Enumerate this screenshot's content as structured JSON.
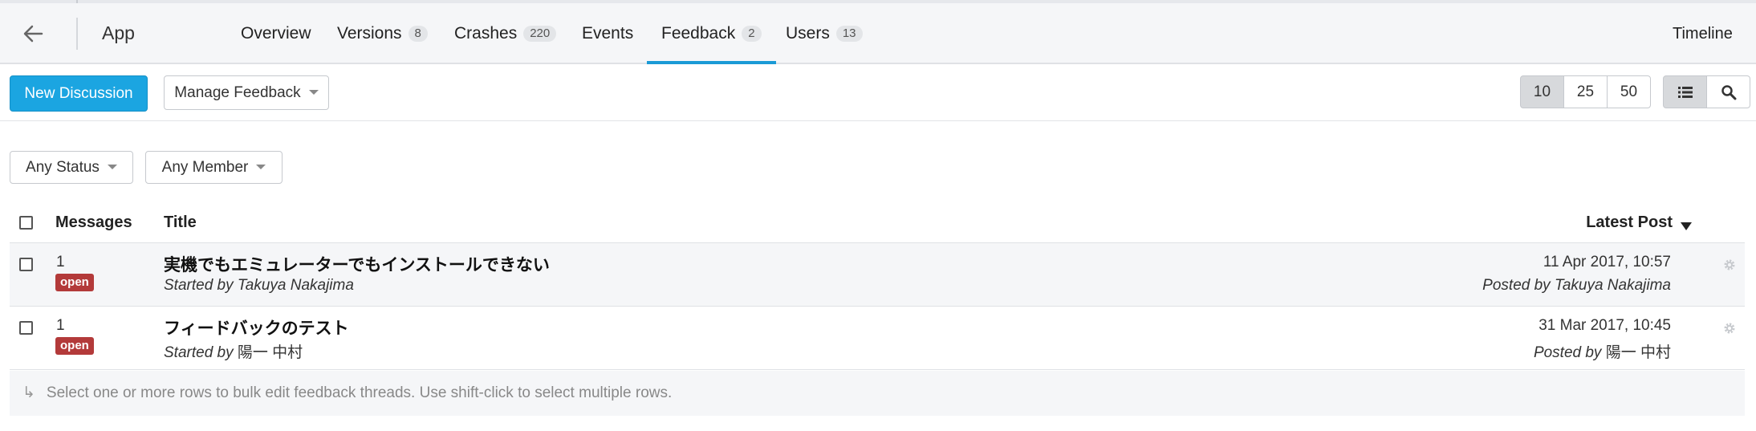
{
  "header": {
    "app_title": "App",
    "back_icon": "arrow-left-icon",
    "tabs": [
      {
        "label": "Overview",
        "badge": ""
      },
      {
        "label": "Versions",
        "badge": "8"
      },
      {
        "label": "Crashes",
        "badge": "220"
      },
      {
        "label": "Events",
        "badge": ""
      },
      {
        "label": "Feedback",
        "badge": "2",
        "active": true
      },
      {
        "label": "Users",
        "badge": "13"
      }
    ],
    "timeline_label": "Timeline"
  },
  "toolbar": {
    "new_discussion_label": "New Discussion",
    "manage_feedback_label": "Manage Feedback",
    "page_sizes": [
      "10",
      "25",
      "50"
    ],
    "selected_page_size": "10",
    "view_icons": [
      "list-view-icon",
      "search-icon"
    ]
  },
  "filters": {
    "status_label": "Any Status",
    "member_label": "Any Member"
  },
  "table": {
    "columns": {
      "messages": "Messages",
      "title": "Title",
      "latest_post": "Latest Post"
    },
    "rows": [
      {
        "messages": "1",
        "status": "open",
        "title": "実機でもエミュレーターでもインストールできない",
        "started_prefix": "Started by",
        "started_by": "Takuya Nakajima",
        "date": "11 Apr 2017, 10:57",
        "posted_prefix": "Posted by",
        "posted_by": "Takuya Nakajima"
      },
      {
        "messages": "1",
        "status": "open",
        "title": "フィードバックのテスト",
        "started_prefix": "Started by",
        "started_by": "陽一 中村",
        "date": "31 Mar 2017, 10:45",
        "posted_prefix": "Posted by",
        "posted_by": "陽一 中村"
      }
    ]
  },
  "footer": {
    "hint": "Select one or more rows to bulk edit feedback threads. Use shift-click to select multiple rows."
  },
  "colors": {
    "primary": "#1ba5e1",
    "active_tab_underline": "#1b9ad6",
    "status_open": "#b33a3a"
  }
}
